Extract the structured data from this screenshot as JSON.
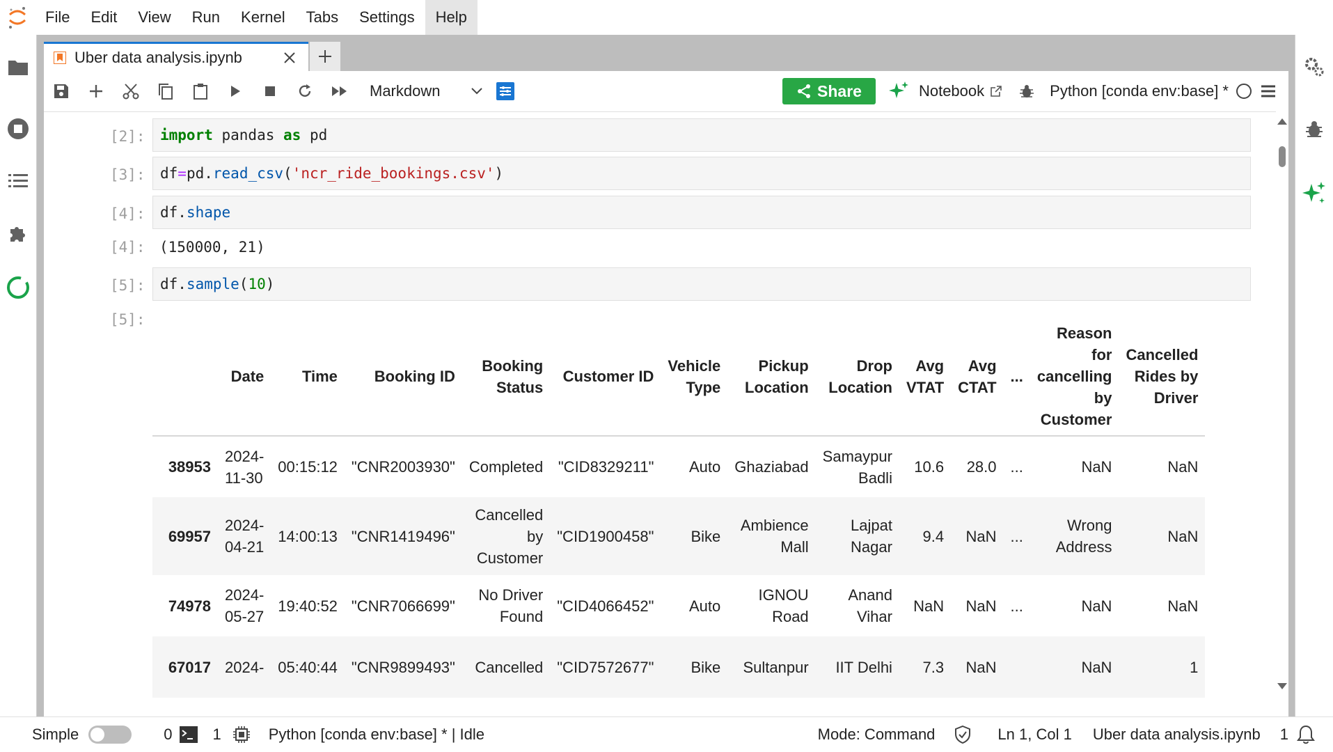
{
  "menu": {
    "logo": "jupyter-logo",
    "items": [
      "File",
      "Edit",
      "View",
      "Run",
      "Kernel",
      "Tabs",
      "Settings",
      "Help"
    ],
    "active": "Help"
  },
  "left_sidebar": [
    "folder-icon",
    "running-icon",
    "toc-icon",
    "extension-icon",
    "git-icon"
  ],
  "right_sidebar": [
    "property-inspector-icon",
    "debugger-icon",
    "ai-assistant-icon"
  ],
  "tabs": [
    {
      "label": "Uber data analysis.ipynb"
    }
  ],
  "toolbar": {
    "cell_type": "Markdown",
    "share_label": "Share",
    "notebook_label": "Notebook",
    "kernel": "Python [conda env:base] *"
  },
  "cells": [
    {
      "prompt": "[2]:",
      "code": "import pandas as pd"
    },
    {
      "prompt": "[3]:",
      "code": "df=pd.read_csv('ncr_ride_bookings.csv')"
    },
    {
      "prompt": "[4]:",
      "code": "df.shape"
    },
    {
      "prompt": "[4]:",
      "output": "(150000, 21)"
    },
    {
      "prompt": "[5]:",
      "code": "df.sample(10)"
    },
    {
      "prompt": "[5]:"
    }
  ],
  "table": {
    "columns": [
      "",
      "Date",
      "Time",
      "Booking ID",
      "Booking Status",
      "Customer ID",
      "Vehicle Type",
      "Pickup Location",
      "Drop Location",
      "Avg VTAT",
      "Avg CTAT",
      "...",
      "Reason for cancelling by Customer",
      "Cancelled Rides by Driver"
    ],
    "rows": [
      [
        "38953",
        "2024-11-30",
        "00:15:12",
        "\"CNR2003930\"",
        "Completed",
        "\"CID8329211\"",
        "Auto",
        "Ghaziabad",
        "Samaypur Badli",
        "10.6",
        "28.0",
        "...",
        "NaN",
        "NaN"
      ],
      [
        "69957",
        "2024-04-21",
        "14:00:13",
        "\"CNR1419496\"",
        "Cancelled by Customer",
        "\"CID1900458\"",
        "Bike",
        "Ambience Mall",
        "Lajpat Nagar",
        "9.4",
        "NaN",
        "...",
        "Wrong Address",
        "NaN"
      ],
      [
        "74978",
        "2024-05-27",
        "19:40:52",
        "\"CNR7066699\"",
        "No Driver Found",
        "\"CID4066452\"",
        "Auto",
        "IGNOU Road",
        "Anand Vihar",
        "NaN",
        "NaN",
        "...",
        "NaN",
        "NaN"
      ],
      [
        "67017",
        "2024-",
        "05:40:44",
        "\"CNR9899493\"",
        "Cancelled",
        "\"CID7572677\"",
        "Bike",
        "Sultanpur",
        "IIT Delhi",
        "7.3",
        "NaN",
        "",
        "NaN",
        "1"
      ]
    ]
  },
  "status": {
    "mode_label": "Simple",
    "terminals": "0",
    "kernels": "1",
    "kernel_status": "Python [conda env:base] * | Idle",
    "mode": "Mode: Command",
    "cursor": "Ln 1, Col 1",
    "file": "Uber data analysis.ipynb",
    "notifications": "1"
  },
  "colors": {
    "accent": "#1976d2",
    "share": "#28a745",
    "jupyter_orange": "#f37726",
    "ai_green": "#1aa34a"
  }
}
